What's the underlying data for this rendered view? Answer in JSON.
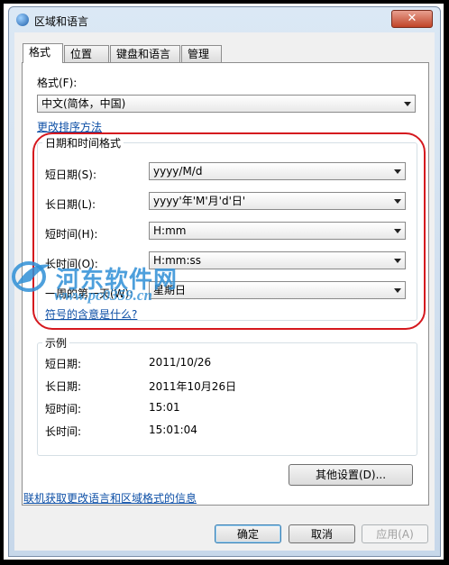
{
  "window": {
    "title": "区域和语言",
    "close": "✕"
  },
  "tabs": [
    {
      "label": "格式"
    },
    {
      "label": "位置"
    },
    {
      "label": "键盘和语言"
    },
    {
      "label": "管理"
    }
  ],
  "format": {
    "label": "格式(F):",
    "value": "中文(简体，中国)",
    "sort_link": "更改排序方法"
  },
  "datetime": {
    "group_title": "日期和时间格式",
    "short_date_label": "短日期(S):",
    "short_date_value": "yyyy/M/d",
    "long_date_label": "长日期(L):",
    "long_date_value": "yyyy'年'M'月'd'日'",
    "short_time_label": "短时间(H):",
    "short_time_value": "H:mm",
    "long_time_label": "长时间(O):",
    "long_time_value": "H:mm:ss",
    "first_day_label": "一周的第一天(W):",
    "first_day_value": "星期日",
    "symbols_link": "符号的含意是什么?"
  },
  "example": {
    "group_title": "示例",
    "rows": [
      {
        "label": "短日期:",
        "value": "2011/10/26"
      },
      {
        "label": "长日期:",
        "value": "2011年10月26日"
      },
      {
        "label": "短时间:",
        "value": "15:01"
      },
      {
        "label": "长时间:",
        "value": "15:01:04"
      }
    ]
  },
  "other_settings_button": "其他设置(D)...",
  "online_link": "联机获取更改语言和区域格式的信息",
  "buttons": {
    "ok": "确定",
    "cancel": "取消",
    "apply": "应用(A)"
  },
  "watermark": {
    "text": "河东软件网",
    "url": "www.pc0359.cn"
  }
}
